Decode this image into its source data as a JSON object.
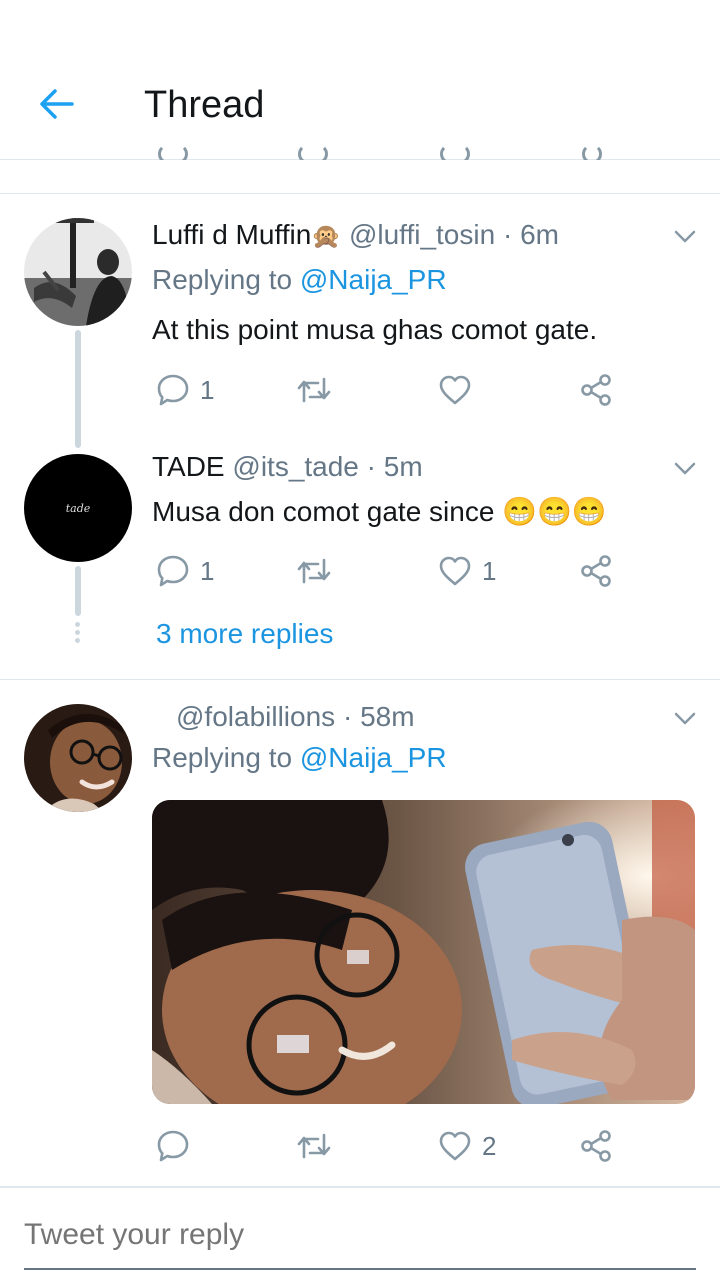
{
  "header": {
    "title": "Thread"
  },
  "tweets": [
    {
      "name": "Luffi d Muffin",
      "name_emoji": "🙊",
      "handle": "@luffi_tosin",
      "time": "6m",
      "replying_prefix": "Replying to ",
      "replying_to": "@Naija_PR",
      "text": "At this point musa ghas comot gate.",
      "reply_count": "1",
      "retweet_count": "",
      "like_count": ""
    },
    {
      "name": "TADE",
      "handle": "@its_tade",
      "time": "5m",
      "text": "Musa don comot gate since 😁😁😁",
      "avatar_text": "tade",
      "reply_count": "1",
      "retweet_count": "",
      "like_count": "1"
    },
    {
      "name": "",
      "handle": "@folabillions",
      "time": "58m",
      "replying_prefix": "Replying to ",
      "replying_to": "@Naija_PR",
      "reply_count": "",
      "retweet_count": "",
      "like_count": "2"
    }
  ],
  "more_replies": "3 more replies",
  "separator": " · ",
  "reply_placeholder": "Tweet your reply",
  "colors": {
    "accent": "#1b95e0",
    "muted": "#657786",
    "icon": "#8899a6",
    "divider": "#e1e8ed"
  }
}
